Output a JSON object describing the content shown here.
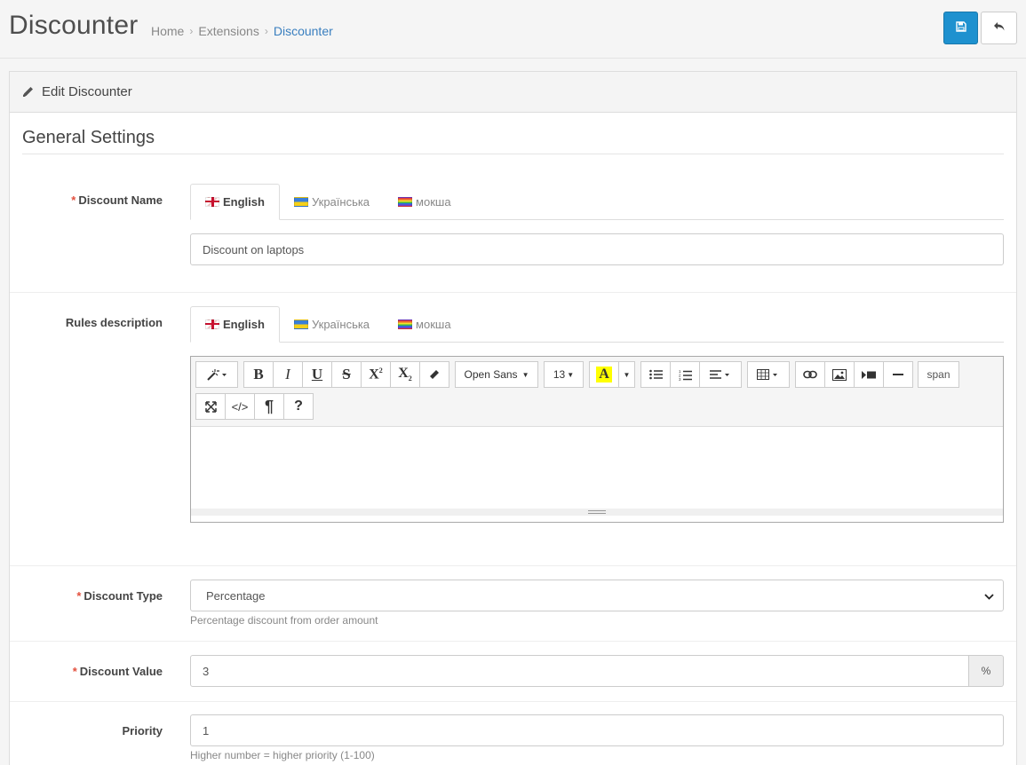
{
  "header": {
    "title": "Discounter",
    "breadcrumb": [
      "Home",
      "Extensions",
      "Discounter"
    ],
    "separator": "›",
    "save_icon": "floppy-disk-icon",
    "back_icon": "reply-arrow-icon"
  },
  "panel": {
    "heading": "Edit Discounter",
    "heading_icon": "pencil-icon",
    "legend": "General Settings"
  },
  "languages": [
    {
      "label": "English",
      "flag": "gb"
    },
    {
      "label": "Українська",
      "flag": "ua"
    },
    {
      "label": "мокша",
      "flag": "rainbow"
    }
  ],
  "form": {
    "discount_name": {
      "label": "Discount Name",
      "required": "*",
      "value": "Discount on laptops"
    },
    "rules_description": {
      "label": "Rules description"
    },
    "discount_type": {
      "label": "Discount Type",
      "required": "*",
      "value": "Percentage",
      "help": "Percentage discount from order amount"
    },
    "discount_value": {
      "label": "Discount Value",
      "required": "*",
      "value": "3",
      "addon": "%"
    },
    "priority": {
      "label": "Priority",
      "value": "1",
      "help": "Higher number = higher priority (1-100)"
    }
  },
  "editor_toolbar": {
    "font_family": "Open Sans",
    "font_size": "13",
    "color_letter": "A",
    "style_tag": "span",
    "colors": {
      "highlight": "#ffff00"
    }
  },
  "colors": {
    "primary": "#1e91cf",
    "link": "#3a7fbf",
    "required": "#e3503e"
  }
}
